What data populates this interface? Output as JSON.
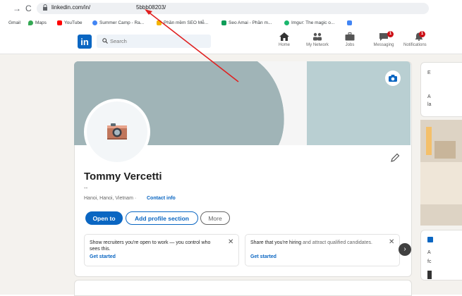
{
  "browser": {
    "url_prefix": "linkedin.com/in/",
    "url_suffix": "5bbb08203/"
  },
  "bookmarks": [
    {
      "label": "Gmail",
      "color": "#5f6368"
    },
    {
      "label": "Maps",
      "color": "#34a853"
    },
    {
      "label": "YouTube",
      "color": "#ff0000"
    },
    {
      "label": "Summer Camp - Ra...",
      "color": "#4285f4"
    },
    {
      "label": "Phần mềm SEO Mễ...",
      "color": "#f4b400"
    },
    {
      "label": "Seo Amai - Phần m...",
      "color": "#0f9d58"
    },
    {
      "label": "Imgur: The magic o...",
      "color": "#1bb76e"
    },
    {
      "label": "",
      "color": "#4285f4"
    }
  ],
  "linkedin": {
    "logo_text": "in",
    "search_placeholder": "Search",
    "nav": [
      {
        "label": "Home",
        "icon": "home-icon",
        "badge": ""
      },
      {
        "label": "My Network",
        "icon": "network-icon",
        "badge": ""
      },
      {
        "label": "Jobs",
        "icon": "briefcase-icon",
        "badge": ""
      },
      {
        "label": "Messaging",
        "icon": "messaging-icon",
        "badge": "1"
      },
      {
        "label": "Notifications",
        "icon": "bell-icon",
        "badge": "1"
      }
    ]
  },
  "profile": {
    "name": "Tommy Vercetti",
    "headline": "--",
    "location": "Hanoi, Hanoi, Vietnam ·",
    "contact_info": "Contact info",
    "buttons": {
      "open_to": "Open to",
      "add_section": "Add profile section",
      "more": "More"
    },
    "promos": [
      {
        "text_bold": "Show recruiters you're open to work",
        "text_rest": " — you control who sees this.",
        "link": "Get started"
      },
      {
        "text_bold": "Share that you're hiring",
        "text_rest": " and attract qualified candidates.",
        "link": "Get started"
      }
    ],
    "next_arrow": "›",
    "close_glyph": "✕"
  },
  "right_rail": {
    "card1_letter1": "E",
    "card1_letter2": "A",
    "card1_letter3": "la",
    "card3_letter1": "A",
    "card3_letter2": "fc"
  },
  "colors": {
    "accent": "#0a66c2",
    "banner": "#a0b4b7",
    "annotation_arrow": "#e02020"
  }
}
